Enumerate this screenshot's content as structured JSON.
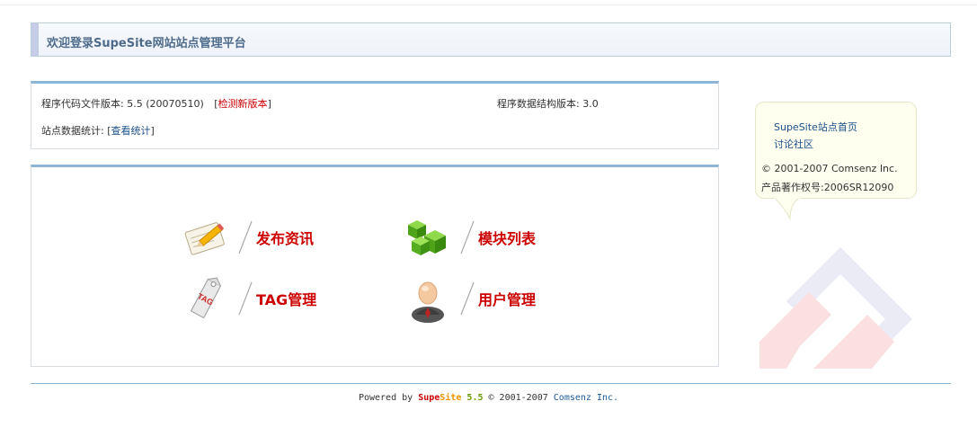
{
  "header": {
    "welcome_title": "欢迎登录SupeSite网站站点管理平台"
  },
  "info": {
    "code_version_label": "程序代码文件版本: 5.5 (20070510)",
    "check_update_link": "检测新版本",
    "db_version_label": "程序数据结构版本: 3.0",
    "stats_label": "站点数据统计:",
    "view_stats_link": "查看统计"
  },
  "menu": {
    "publish": "发布资讯",
    "modules": "模块列表",
    "tag": "TAG管理",
    "users": "用户管理"
  },
  "sidebar": {
    "home_link": "SupeSite站点首页",
    "forum_link": "讨论社区",
    "copyright": "© 2001-2007 Comsenz Inc.",
    "license": "产品著作权号:2006SR12090"
  },
  "footer": {
    "powered": "Powered by",
    "brand_a": "Supe",
    "brand_b": "Site",
    "version": "5.5",
    "copy": "© 2001-2007",
    "company": "Comsenz Inc."
  },
  "colors": {
    "accent_red": "#cc0000",
    "link_blue": "#1a4f8a",
    "border_blue": "#8db5d6"
  }
}
